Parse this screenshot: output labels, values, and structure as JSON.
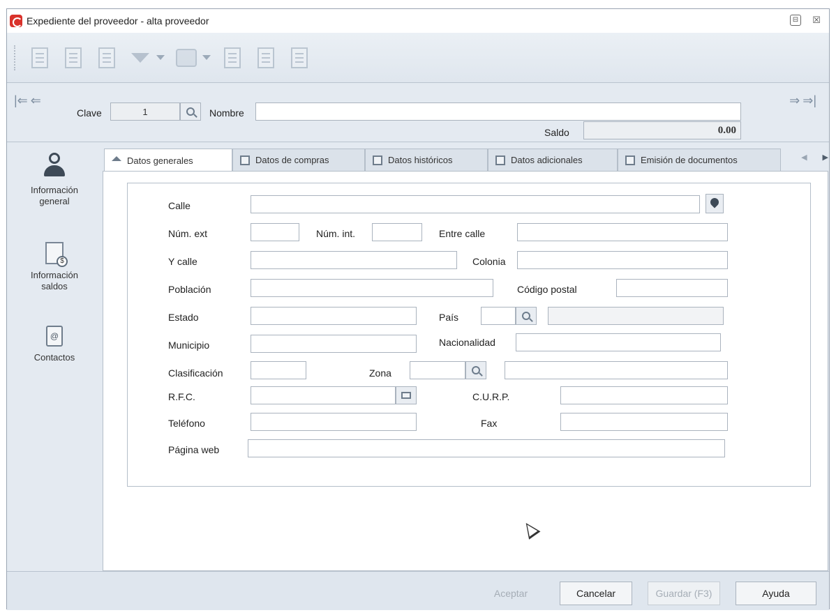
{
  "window": {
    "title": "Expediente del proveedor - alta proveedor",
    "controls": {
      "minimize": "⊟",
      "close": "☒"
    }
  },
  "toolbar": {
    "icons": [
      "new-document-icon",
      "copy-document-icon",
      "list-document-icon",
      "filter-icon",
      "network-icon",
      "report-icon",
      "clipboard-icon",
      "database-icon"
    ]
  },
  "nav": {
    "clave_label": "Clave",
    "clave_value": "1",
    "nombre_label": "Nombre",
    "nombre_value": "",
    "saldo_label": "Saldo",
    "saldo_value": "0.00"
  },
  "sidebar": {
    "items": [
      {
        "label": "Información general",
        "icon": "person-icon"
      },
      {
        "label": "Información saldos",
        "icon": "balance-document-icon"
      },
      {
        "label": "Contactos",
        "icon": "contact-card-icon"
      }
    ]
  },
  "tabs": [
    {
      "label": "Datos generales",
      "active": true
    },
    {
      "label": "Datos de compras",
      "active": false
    },
    {
      "label": "Datos históricos",
      "active": false
    },
    {
      "label": "Datos adicionales",
      "active": false
    },
    {
      "label": "Emisión de documentos",
      "active": false
    }
  ],
  "form": {
    "calle": "Calle",
    "num_ext": "Núm. ext",
    "num_int": "Núm. int.",
    "entre_calle": "Entre calle",
    "y_calle": "Y calle",
    "colonia": "Colonia",
    "poblacion": "Población",
    "codigo_postal": "Código postal",
    "estado": "Estado",
    "pais": "País",
    "municipio": "Municipio",
    "nacionalidad": "Nacionalidad",
    "clasificacion": "Clasificación",
    "zona": "Zona",
    "rfc": "R.F.C.",
    "curp": "C.U.R.P.",
    "telefono": "Teléfono",
    "fax": "Fax",
    "pagina_web": "Página web"
  },
  "buttons": {
    "aceptar": "Aceptar",
    "cancelar": "Cancelar",
    "guardar": "Guardar (F3)",
    "ayuda": "Ayuda"
  },
  "colors": {
    "window_bg": "#e4eaf1",
    "panel_bg": "#ffffff",
    "app_icon": "#d9322b"
  }
}
